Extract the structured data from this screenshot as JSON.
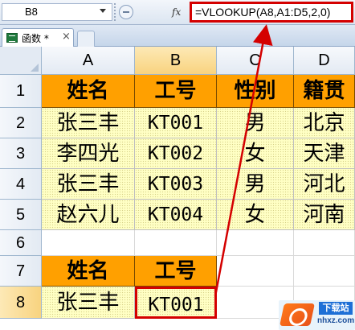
{
  "formula_bar": {
    "name_box": "B8",
    "fx_label": "fx",
    "formula": "=VLOOKUP(A8,A1:D5,2,0)"
  },
  "tab": {
    "label": "函数 *",
    "close_glyph": "×"
  },
  "columns": [
    "A",
    "B",
    "C",
    "D"
  ],
  "active_column": "B",
  "rows": [
    "1",
    "2",
    "3",
    "4",
    "5",
    "6",
    "7",
    "8"
  ],
  "active_row": "8",
  "table": {
    "headers": [
      "姓名",
      "工号",
      "性别",
      "籍贯"
    ],
    "records": [
      [
        "张三丰",
        "KT001",
        "男",
        "北京"
      ],
      [
        "李四光",
        "KT002",
        "女",
        "天津"
      ],
      [
        "张三丰",
        "KT003",
        "男",
        "河北"
      ],
      [
        "赵六儿",
        "KT004",
        "女",
        "河南"
      ]
    ]
  },
  "lookup": {
    "headers": [
      "姓名",
      "工号"
    ],
    "values": [
      "张三丰",
      "KT001"
    ]
  },
  "colors": {
    "header_fill": "#ffa000",
    "data_fill": "#ffffc4",
    "highlight_border": "#d40000"
  },
  "watermark": {
    "label": "下载站",
    "url": "nhxz.com"
  }
}
